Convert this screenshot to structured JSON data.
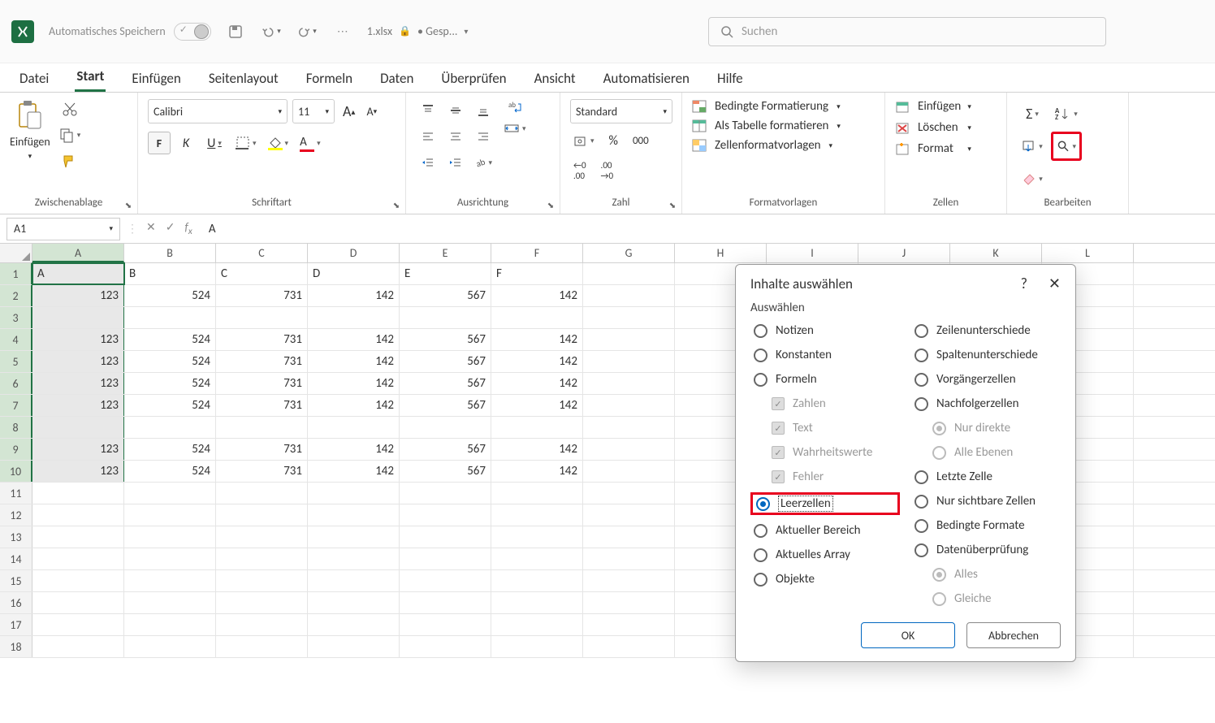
{
  "title": {
    "autosave_label": "Automatisches Speichern",
    "filename": "1.xlsx",
    "save_status": "• Gesp...",
    "search_placeholder": "Suchen"
  },
  "tabs": [
    "Datei",
    "Start",
    "Einfügen",
    "Seitenlayout",
    "Formeln",
    "Daten",
    "Überprüfen",
    "Ansicht",
    "Automatisieren",
    "Hilfe"
  ],
  "active_tab": "Start",
  "ribbon": {
    "clipboard": {
      "label": "Zwischenablage",
      "paste": "Einfügen"
    },
    "font": {
      "label": "Schriftart",
      "name": "Calibri",
      "size": "11"
    },
    "align": {
      "label": "Ausrichtung"
    },
    "number": {
      "label": "Zahl",
      "format": "Standard"
    },
    "styles": {
      "label": "Formatvorlagen",
      "cond": "Bedingte Formatierung",
      "table": "Als Tabelle formatieren",
      "cell": "Zellenformatvorlagen"
    },
    "cells": {
      "label": "Zellen",
      "insert": "Einfügen",
      "delete": "Löschen",
      "format": "Format"
    },
    "editing": {
      "label": "Bearbeiten"
    }
  },
  "formula_bar": {
    "name_box": "A1",
    "formula": "A"
  },
  "grid": {
    "cols": [
      "A",
      "B",
      "C",
      "D",
      "E",
      "F",
      "G",
      "H",
      "I",
      "J",
      "K",
      "L"
    ],
    "row_count": 18,
    "data": {
      "1": {
        "A": "A",
        "B": "B",
        "C": "C",
        "D": "D",
        "E": "E",
        "F": "F"
      },
      "2": {
        "A": "123",
        "B": "524",
        "C": "731",
        "D": "142",
        "E": "567",
        "F": "142"
      },
      "4": {
        "A": "123",
        "B": "524",
        "C": "731",
        "D": "142",
        "E": "567",
        "F": "142"
      },
      "5": {
        "A": "123",
        "B": "524",
        "C": "731",
        "D": "142",
        "E": "567",
        "F": "142"
      },
      "6": {
        "A": "123",
        "B": "524",
        "C": "731",
        "D": "142",
        "E": "567",
        "F": "142"
      },
      "7": {
        "A": "123",
        "B": "524",
        "C": "731",
        "D": "142",
        "E": "567",
        "F": "142"
      },
      "9": {
        "A": "123",
        "B": "524",
        "C": "731",
        "D": "142",
        "E": "567",
        "F": "142"
      },
      "10": {
        "A": "123",
        "B": "524",
        "C": "731",
        "D": "142",
        "E": "567",
        "F": "142"
      }
    },
    "selected_col": "A",
    "active_cell": "A1",
    "selection_rows": 10
  },
  "dialog": {
    "title": "Inhalte auswählen",
    "subtitle": "Auswählen",
    "left": [
      {
        "id": "notizen",
        "label": "Notizen",
        "type": "radio"
      },
      {
        "id": "konstanten",
        "label": "Konstanten",
        "type": "radio"
      },
      {
        "id": "formeln",
        "label": "Formeln",
        "type": "radio"
      },
      {
        "id": "zahlen",
        "label": "Zahlen",
        "type": "check",
        "disabled": true,
        "checked": true
      },
      {
        "id": "text",
        "label": "Text",
        "type": "check",
        "disabled": true,
        "checked": true
      },
      {
        "id": "wahr",
        "label": "Wahrheitswerte",
        "type": "check",
        "disabled": true,
        "checked": true
      },
      {
        "id": "fehler",
        "label": "Fehler",
        "type": "check",
        "disabled": true,
        "checked": true
      },
      {
        "id": "leer",
        "label": "Leerzellen",
        "type": "radio",
        "selected": true,
        "highlight": true
      },
      {
        "id": "aktbereich",
        "label": "Aktueller Bereich",
        "type": "radio"
      },
      {
        "id": "aktarray",
        "label": "Aktuelles Array",
        "type": "radio"
      },
      {
        "id": "objekte",
        "label": "Objekte",
        "type": "radio"
      }
    ],
    "right": [
      {
        "id": "zeilenunt",
        "label": "Zeilenunterschiede",
        "type": "radio"
      },
      {
        "id": "spaltenunt",
        "label": "Spaltenunterschiede",
        "type": "radio"
      },
      {
        "id": "vorgaenger",
        "label": "Vorgängerzellen",
        "type": "radio"
      },
      {
        "id": "nachfolger",
        "label": "Nachfolgerzellen",
        "type": "radio"
      },
      {
        "id": "direkte",
        "label": "Nur direkte",
        "type": "radio",
        "disabled": true,
        "indent": true,
        "selected": true
      },
      {
        "id": "allee",
        "label": "Alle Ebenen",
        "type": "radio",
        "disabled": true,
        "indent": true
      },
      {
        "id": "letzte",
        "label": "Letzte Zelle",
        "type": "radio"
      },
      {
        "id": "sichtbar",
        "label": "Nur sichtbare Zellen",
        "type": "radio"
      },
      {
        "id": "bedingte",
        "label": "Bedingte Formate",
        "type": "radio"
      },
      {
        "id": "datenueber",
        "label": "Datenüberprüfung",
        "type": "radio"
      },
      {
        "id": "alles",
        "label": "Alles",
        "type": "radio",
        "disabled": true,
        "indent": true,
        "selected": true
      },
      {
        "id": "gleiche",
        "label": "Gleiche",
        "type": "radio",
        "disabled": true,
        "indent": true
      }
    ],
    "ok": "OK",
    "cancel": "Abbrechen"
  }
}
